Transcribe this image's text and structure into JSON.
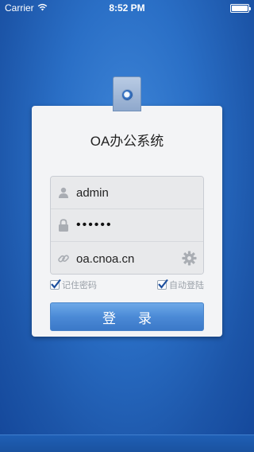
{
  "status_bar": {
    "carrier": "Carrier",
    "time": "8:52 PM",
    "battery_level": 1.0
  },
  "card": {
    "title": "OA办公系统"
  },
  "form": {
    "username": {
      "value": "admin",
      "icon": "user-icon"
    },
    "password": {
      "value": "••••••",
      "icon": "lock-icon"
    },
    "server": {
      "value": "oa.cnoa.cn",
      "icon": "link-icon",
      "action_icon": "gear-icon"
    }
  },
  "options": {
    "remember_password": {
      "label": "记住密码",
      "checked": true
    },
    "auto_login": {
      "label": "自动登陆",
      "checked": true
    }
  },
  "login_button": {
    "label": "登录"
  },
  "colors": {
    "background": "#2a6fc6",
    "button": "#4b8ad6",
    "card": "#f3f4f6"
  }
}
